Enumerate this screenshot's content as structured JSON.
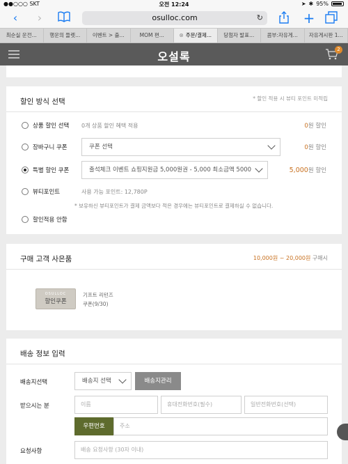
{
  "status": {
    "carrier": "●●○○○ SKT",
    "time": "오전 12:24",
    "battery": "95%"
  },
  "browser": {
    "url": "osulloc.com",
    "tabs": [
      {
        "label": "최순실 운전...",
        "active": false
      },
      {
        "label": "행운의 들렛...",
        "active": false
      },
      {
        "label": "이벤트 > 출...",
        "active": false
      },
      {
        "label": "MOM 편...",
        "active": false
      },
      {
        "label": "주문/결제...",
        "active": true
      },
      {
        "label": "당첨자 발표...",
        "active": false
      },
      {
        "label": "콤부:자유게...",
        "active": false
      },
      {
        "label": "자유게시판 1...",
        "active": false
      }
    ]
  },
  "header": {
    "logo": "오설록",
    "cart_count": "2"
  },
  "discount": {
    "title": "할인 방식 선택",
    "note": "* 할인 적용 시 뷰티 포인트 미적립",
    "options": [
      {
        "label": "상품 할인 선택",
        "desc": "0개 상품 할인 혜택 적용",
        "amount": "0",
        "unit": "원 할인"
      },
      {
        "label": "장바구니 쿠폰",
        "select": "쿠폰 선택",
        "amount": "0",
        "unit": "원 할인"
      },
      {
        "label": "특별 할인 쿠폰",
        "select": "출석체크 이벤트 쇼핑지원금 5,000원권 - 5,000 최소금액 5000",
        "amount": "5,000",
        "unit": "원 할인"
      },
      {
        "label": "뷰티포인트",
        "desc": "사용 가능 포인트: 12,780P",
        "note": "* 보유하신 뷰티포인트가 결제 금액보다 적은 경우에는 뷰티포인트로 결제하실 수 없습니다."
      },
      {
        "label": "할인적용 안함"
      }
    ]
  },
  "gift": {
    "title": "구매 고객 사은품",
    "range": "10,000원 ~ 20,000원",
    "range_suffix": "구매시",
    "coupon_brand": "OSULLOC",
    "coupon_label": "할인쿠폰",
    "item_name": "기프트 리턴즈",
    "item_sub": "쿠폰(9/30)"
  },
  "shipping": {
    "title": "배송 정보 입력",
    "dest_label": "배송지선택",
    "dest_select": "배송지 선택",
    "manage_button": "배송지관리",
    "recipient_label": "받으시는 분",
    "name_placeholder": "이름",
    "mobile_placeholder": "휴대전화번호(필수)",
    "phone_placeholder": "일반전화번호(선택)",
    "zip_button": "우편번호",
    "address_placeholder": "주소",
    "request_label": "요청사항",
    "request_placeholder": "배송 요청사항 (30자 이내)"
  },
  "colors": {
    "accent": "#c8701f",
    "olive": "#5e6b2d",
    "header": "#5a5a5a",
    "gray_button": "#8a8a8a"
  }
}
